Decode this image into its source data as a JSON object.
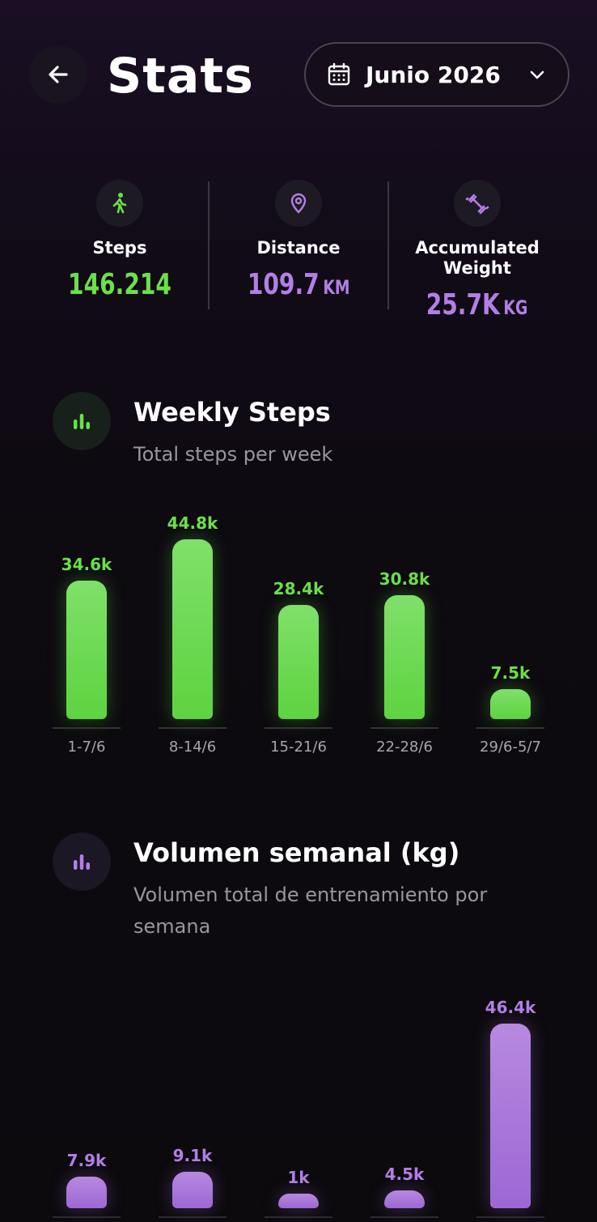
{
  "header": {
    "title": "Stats",
    "month_label": "Junio 2026"
  },
  "summary": [
    {
      "name": "Steps",
      "value": "146.214",
      "unit": ""
    },
    {
      "name": "Distance",
      "value": "109.7",
      "unit": "KM"
    },
    {
      "name": "Accumulated Weight",
      "value": "25.7K",
      "unit": "KG"
    }
  ],
  "weekly_steps": {
    "title": "Weekly Steps",
    "subtitle": "Total steps per week"
  },
  "weekly_volume": {
    "title": "Volumen semanal (kg)",
    "subtitle": "Volumen total de entrenamiento por semana"
  },
  "colors": {
    "accent_green": "#6be04a",
    "accent_purple": "#b27fe6",
    "background": "#0d0a10"
  },
  "icons": {
    "back": "arrow-left-icon",
    "calendar": "calendar-icon",
    "dropdown": "chevron-down-icon",
    "steps": "walking-person-icon",
    "distance": "location-pin-icon",
    "weight": "dumbbell-icon",
    "chart": "bar-chart-icon"
  },
  "chart_data": [
    {
      "type": "bar",
      "title": "Weekly Steps",
      "categories": [
        "1-7/6",
        "8-14/6",
        "15-21/6",
        "22-28/6",
        "29/6-5/7"
      ],
      "values": [
        34.6,
        44.8,
        28.4,
        30.8,
        7.5
      ],
      "value_labels": [
        "34.6k",
        "44.8k",
        "28.4k",
        "30.8k",
        "7.5k"
      ],
      "color": "#6be04a"
    },
    {
      "type": "bar",
      "title": "Volumen semanal (kg)",
      "categories": [
        "",
        "",
        "",
        "",
        ""
      ],
      "values": [
        7.9,
        9.1,
        1,
        4.5,
        46.4
      ],
      "value_labels": [
        "7.9k",
        "9.1k",
        "1k",
        "4.5k",
        "46.4k"
      ],
      "color": "#b27fe6"
    }
  ]
}
